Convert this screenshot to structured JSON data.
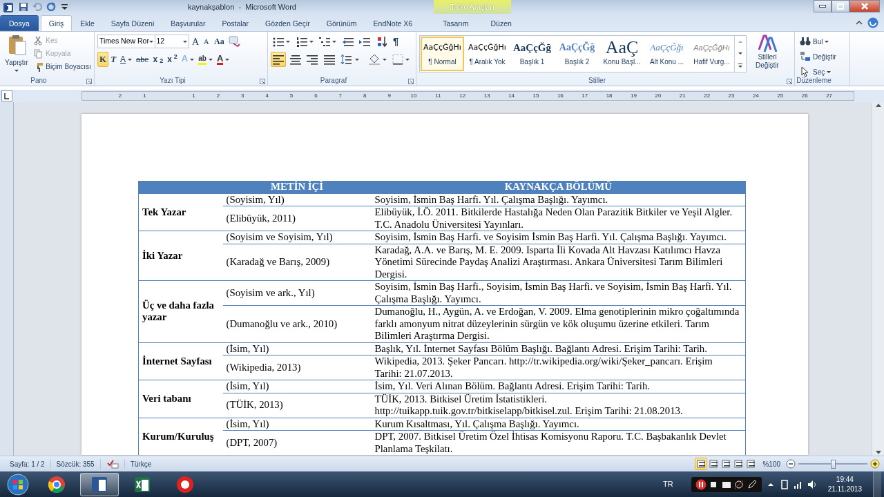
{
  "window": {
    "title": "kaynakşablon  -  Microsoft Word",
    "contextual": {
      "title": "Tablo Araçları",
      "tabs": [
        {
          "label": "Tasarım",
          "selected": false
        },
        {
          "label": "Düzen",
          "selected": false
        }
      ]
    }
  },
  "tabs": [
    {
      "label": "Dosya",
      "kind": "file",
      "selected": false
    },
    {
      "label": "Giriş",
      "kind": "tab",
      "selected": true
    },
    {
      "label": "Ekle",
      "kind": "tab",
      "selected": false
    },
    {
      "label": "Sayfa Düzeni",
      "kind": "tab",
      "selected": false
    },
    {
      "label": "Başvurular",
      "kind": "tab",
      "selected": false
    },
    {
      "label": "Postalar",
      "kind": "tab",
      "selected": false
    },
    {
      "label": "Gözden Geçir",
      "kind": "tab",
      "selected": false
    },
    {
      "label": "Görünüm",
      "kind": "tab",
      "selected": false
    },
    {
      "label": "EndNote X6",
      "kind": "tab",
      "selected": false
    }
  ],
  "ribbon": {
    "clipboard": {
      "label": "Pano",
      "paste": "Yapıştır",
      "items": [
        {
          "label": "Kes",
          "disabled": true
        },
        {
          "label": "Kopyala",
          "disabled": true
        },
        {
          "label": "Biçim Boyacısı",
          "disabled": false
        }
      ]
    },
    "font": {
      "label": "Yazı Tipi",
      "font_name": "Times New Ror",
      "font_size": "12",
      "size_buttons": [
        "A",
        "A"
      ],
      "case_button": "Aa",
      "format_buttons": [
        {
          "label": "K",
          "selected": true
        },
        {
          "label": "T",
          "selected": false
        },
        {
          "label": "A",
          "selected": false
        },
        {
          "label": "abe",
          "selected": false
        },
        {
          "label": "x$_{2}$",
          "selected": false
        },
        {
          "label": "x$^{2}$",
          "selected": false
        }
      ],
      "color_buttons": [
        "A",
        "ab",
        "A"
      ]
    },
    "paragraph": {
      "label": "Paragraf",
      "pilcrow": "¶",
      "align_buttons": [
        {
          "selected": true
        },
        {
          "selected": false
        },
        {
          "selected": false
        },
        {
          "selected": false
        }
      ]
    },
    "styles": {
      "label": "Stiller",
      "items": [
        {
          "preview": "AaÇçĞğHı",
          "label": "¶ Normal",
          "kind": "normal",
          "selected": true
        },
        {
          "preview": "AaÇçĞğHı",
          "label": "¶ Aralık Yok",
          "kind": "normal",
          "selected": false
        },
        {
          "preview": "AaÇçĞğ",
          "label": "Başlık 1",
          "kind": "heading1",
          "selected": false
        },
        {
          "preview": "AaÇçĞğ",
          "label": "Başlık 2",
          "kind": "heading2",
          "selected": false
        },
        {
          "preview": "AaÇ",
          "label": "Konu Başl...",
          "kind": "title",
          "selected": false
        },
        {
          "preview": "AaÇçĞğı",
          "label": "Alt Konu ...",
          "kind": "subtitle",
          "selected": false
        },
        {
          "preview": "AaÇçĞğHı",
          "label": "Hafif Vurg...",
          "kind": "emphasis",
          "selected": false
        }
      ],
      "change": "Stilleri Değiştir"
    },
    "editing": {
      "label": "Düzenleme",
      "items": [
        "Bul",
        "Değiştir",
        "Seç"
      ]
    }
  },
  "ruler": [
    "2",
    "1",
    "1",
    "2",
    "3",
    "4",
    "5",
    "6",
    "7",
    "8",
    "9",
    "10",
    "11",
    "12",
    "13",
    "14",
    "15",
    "16",
    "17",
    "18",
    "19",
    "20",
    "21",
    "22",
    "23",
    "24",
    "25",
    "26",
    "27"
  ],
  "table": {
    "columns": [
      "METİN İÇİ",
      "KAYNAKÇA BÖLÜMÜ"
    ],
    "groups": [
      {
        "category": "Tek Yazar",
        "entries": [
          {
            "citation": "(Soyisim, Yıl)",
            "reference": "Soyisim, İsmin Baş Harfi. Yıl. Çalışma Başlığı. Yayımcı."
          },
          {
            "citation": "(Elibüyük, 2011)",
            "reference": "Elibüyük, İ.Ö. 2011. Bitkilerde Hastalığa Neden Olan Parazitik Bitkiler ve Yeşil Algler. T.C. Anadolu Üniversitesi Yayınları."
          }
        ]
      },
      {
        "category": "İki Yazar",
        "entries": [
          {
            "citation": "(Soyisim ve Soyisim, Yıl)",
            "reference": "Soyisim, İsmin Baş Harfi. ve Soyisim İsmin Baş Harfi. Yıl. Çalışma Başlığı. Yayımcı."
          },
          {
            "citation": "(Karadağ ve Barış, 2009)",
            "reference": "Karadağ, A.A. ve Barış, M. E. 2009. Isparta İli Kovada Alt Havzası Katılımcı Havza Yönetimi Sürecinde Paydaş Analizi Araştırması. Ankara Üniversitesi Tarım Bilimleri Dergisi."
          }
        ]
      },
      {
        "category": "Üç ve daha fazla yazar",
        "entries": [
          {
            "citation": "(Soyisim ve ark., Yıl)",
            "reference": "Soyisim, İsmin Baş Harfi., Soyisim, İsmin Baş Harfi. ve Soyisim, İsmin Baş Harfi. Yıl. Çalışma Başlığı. Yayımcı."
          },
          {
            "citation": "(Dumanoğlu ve ark., 2010)",
            "reference": "Dumanoğlu, H., Aygün, A. ve Erdoğan, V. 2009. Elma genotiplerinin mikro çoğaltımında farklı amonyum nitrat düzeylerinin sürgün ve kök oluşumu üzerine etkileri. Tarım Bilimleri Araştırma Dergisi."
          }
        ]
      },
      {
        "category": "İnternet Sayfası",
        "entries": [
          {
            "citation": "(İsim, Yıl)",
            "reference": "Başlık, Yıl. İnternet Sayfası Bölüm Başlığı. Bağlantı Adresi. Erişim Tarihi: Tarih."
          },
          {
            "citation": "(Wikipedia, 2013)",
            "reference": "Wikipedia, 2013. Şeker Pancarı. http://tr.wikipedia.org/wiki/Şeker_pancarı. Erişim Tarihi: 21.07.2013."
          }
        ]
      },
      {
        "category": "Veri tabanı",
        "entries": [
          {
            "citation": "(İsim, Yıl)",
            "reference": "İsim, Yıl. Veri Alınan Bölüm. Bağlantı Adresi. Erişim Tarihi: Tarih."
          },
          {
            "citation": "(TÜİK, 2013)",
            "reference": "TÜİK, 2013. Bitkisel Üretim İstatistikleri. http://tuikapp.tuik.gov.tr/bitkiselapp/bitkisel.zul. Erişim Tarihi: 21.08.2013."
          }
        ]
      },
      {
        "category": "Kurum/Kuruluş",
        "entries": [
          {
            "citation": "(İsim, Yıl)",
            "reference": "Kurum Kısaltması, Yıl. Çalışma Başlığı. Yayımcı."
          },
          {
            "citation": "(DPT, 2007)",
            "reference": "DPT, 2007. Bitkisel Üretim Özel İhtisas Komisyonu Raporu. T.C. Başbakanlık Devlet Planlama Teşkilatı."
          }
        ]
      }
    ]
  },
  "status_bar": {
    "page": "Sayfa: 1 / 2",
    "words": "Sözcük: 355",
    "language": "Türkçe",
    "zoom": "%100",
    "zoom_slider": {
      "level": 0.5
    }
  },
  "taskbar": {
    "apps": [
      {
        "kind": "chrome",
        "selected": false
      },
      {
        "kind": "word",
        "selected": true
      },
      {
        "kind": "excel",
        "selected": false
      },
      {
        "kind": "recorder",
        "selected": false
      }
    ],
    "language": "TR",
    "time": "19:44",
    "date": "21.11.2013"
  }
}
